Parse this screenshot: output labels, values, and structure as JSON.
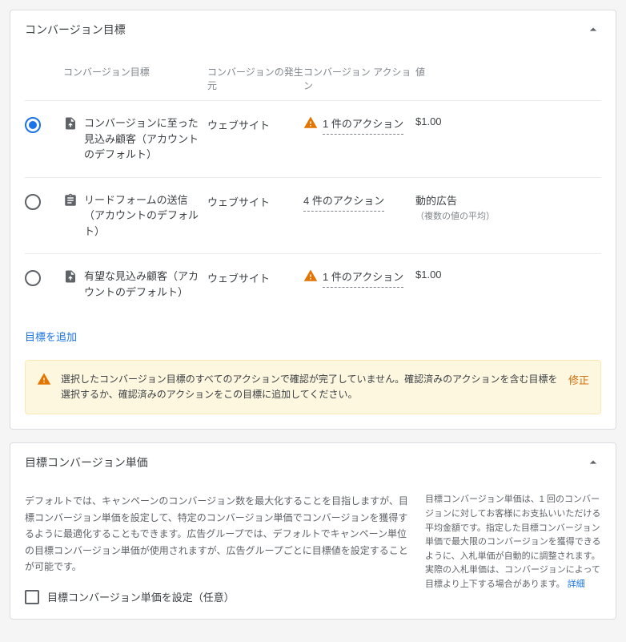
{
  "section1": {
    "title": "コンバージョン目標",
    "headers": {
      "goal": "コンバージョン目標",
      "source": "コンバージョンの発生元",
      "action": "コンバージョン アクション",
      "value": "値"
    },
    "rows": [
      {
        "selected": true,
        "icon": "submit",
        "goal": "コンバージョンに至った見込み顧客（アカウントのデフォルト）",
        "source": "ウェブサイト",
        "warn": true,
        "action": "1 件のアクション",
        "value": "$1.00"
      },
      {
        "selected": false,
        "icon": "form",
        "goal": "リードフォームの送信（アカウントのデフォルト）",
        "source": "ウェブサイト",
        "warn": false,
        "action": "4 件のアクション",
        "value": "動的広告",
        "value_note": "（複数の値の平均）"
      },
      {
        "selected": false,
        "icon": "submit",
        "goal": "有望な見込み顧客（アカウントのデフォルト）",
        "source": "ウェブサイト",
        "warn": true,
        "action": "1 件のアクション",
        "value": "$1.00"
      }
    ],
    "add_goal": "目標を追加",
    "alert": {
      "text": "選択したコンバージョン目標のすべてのアクションで確認が完了していません。確認済みのアクションを含む目標を選択するか、確認済みのアクションをこの目標に追加してください。",
      "fix": "修正"
    }
  },
  "section2": {
    "title": "目標コンバージョン単価",
    "desc": "デフォルトでは、キャンペーンのコンバージョン数を最大化することを目指しますが、目標コンバージョン単価を設定して、特定のコンバージョン単価でコンバージョンを獲得するように最適化することもできます。広告グループでは、デフォルトでキャンペーン単位の目標コンバージョン単価が使用されますが、広告グループごとに目標値を設定することが可能です。",
    "side": "目標コンバージョン単価は、1 回のコンバージョンに対してお客様にお支払いいただける平均金額です。指定した目標コンバージョン単価で最大限のコンバージョンを獲得できるように、入札単価が自動的に調整されます。実際の入札単価は、コンバージョンによって目標より上下する場合があります。",
    "side_link": "詳細",
    "checkbox_label": "目標コンバージョン単価を設定（任意）"
  }
}
